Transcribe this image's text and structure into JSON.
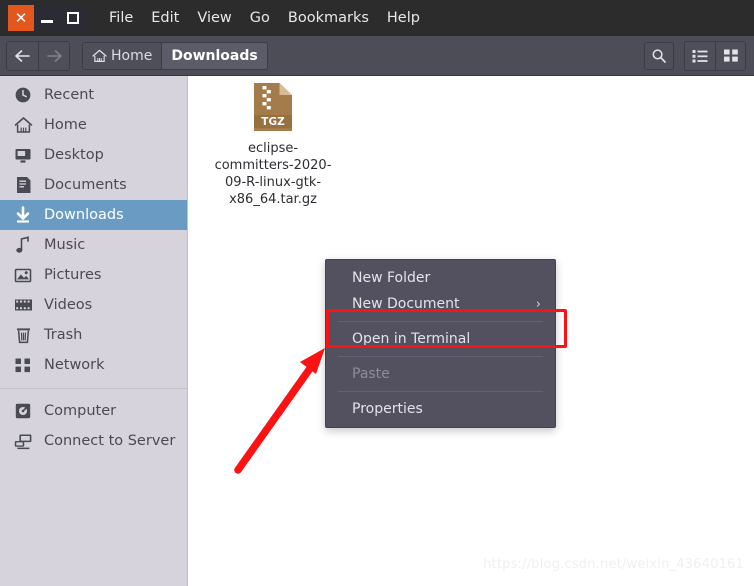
{
  "window": {
    "controls": [
      {
        "name": "close",
        "glyph": "✕"
      },
      {
        "name": "minimize",
        "glyph": "—"
      },
      {
        "name": "maximize",
        "glyph": "□"
      }
    ],
    "menubar": [
      "File",
      "Edit",
      "View",
      "Go",
      "Bookmarks",
      "Help"
    ]
  },
  "toolbar": {
    "back_label": "←",
    "forward_label": "→",
    "breadcrumbs": [
      {
        "label": "Home",
        "icon": "home-icon",
        "active": false
      },
      {
        "label": "Downloads",
        "icon": "",
        "active": true
      }
    ],
    "search_label": "search-icon",
    "list_view_label": "list-view-icon",
    "grid_view_label": "grid-view-icon"
  },
  "sidebar": {
    "items": [
      {
        "label": "Recent",
        "icon": "clock-icon",
        "selected": false
      },
      {
        "label": "Home",
        "icon": "home-icon",
        "selected": false
      },
      {
        "label": "Desktop",
        "icon": "desktop-icon",
        "selected": false
      },
      {
        "label": "Documents",
        "icon": "document-icon",
        "selected": false
      },
      {
        "label": "Downloads",
        "icon": "download-icon",
        "selected": true
      },
      {
        "label": "Music",
        "icon": "music-icon",
        "selected": false
      },
      {
        "label": "Pictures",
        "icon": "picture-icon",
        "selected": false
      },
      {
        "label": "Videos",
        "icon": "video-icon",
        "selected": false
      },
      {
        "label": "Trash",
        "icon": "trash-icon",
        "selected": false
      },
      {
        "label": "Network",
        "icon": "network-icon",
        "selected": false
      }
    ],
    "items2": [
      {
        "label": "Computer",
        "icon": "computer-icon",
        "selected": false
      },
      {
        "label": "Connect to Server",
        "icon": "connect-server-icon",
        "selected": false
      }
    ]
  },
  "content": {
    "files": [
      {
        "name": "eclipse-committers-2020-09-R-linux-gtk-x86_64.tar.gz",
        "type_label": "TGZ",
        "icon": "archive-file-icon"
      }
    ]
  },
  "context_menu": {
    "items": [
      {
        "label": "New Folder",
        "disabled": false,
        "submenu": false,
        "sep_after": false
      },
      {
        "label": "New Document",
        "disabled": false,
        "submenu": true,
        "sep_after": true
      },
      {
        "label": "Open in Terminal",
        "disabled": false,
        "submenu": false,
        "sep_after": true
      },
      {
        "label": "Paste",
        "disabled": true,
        "submenu": false,
        "sep_after": true
      },
      {
        "label": "Properties",
        "disabled": false,
        "submenu": false,
        "sep_after": false
      }
    ],
    "submenu_glyph": "›"
  },
  "annotations": {
    "highlight_color": "#fb1212",
    "highlighted_item": "Open in Terminal"
  },
  "watermark": {
    "text": "https://blog.csdn.net/weixin_43640161"
  },
  "colors": {
    "titlebar_bg": "#2c2c2c",
    "toolbar_bg": "#4d4d57",
    "sidebar_bg": "#d6d3dc",
    "selection_blue": "#6a9bc3",
    "menu_bg": "#53515f",
    "close_orange": "#e2571e",
    "file_icon_brown": "#a37c49"
  }
}
